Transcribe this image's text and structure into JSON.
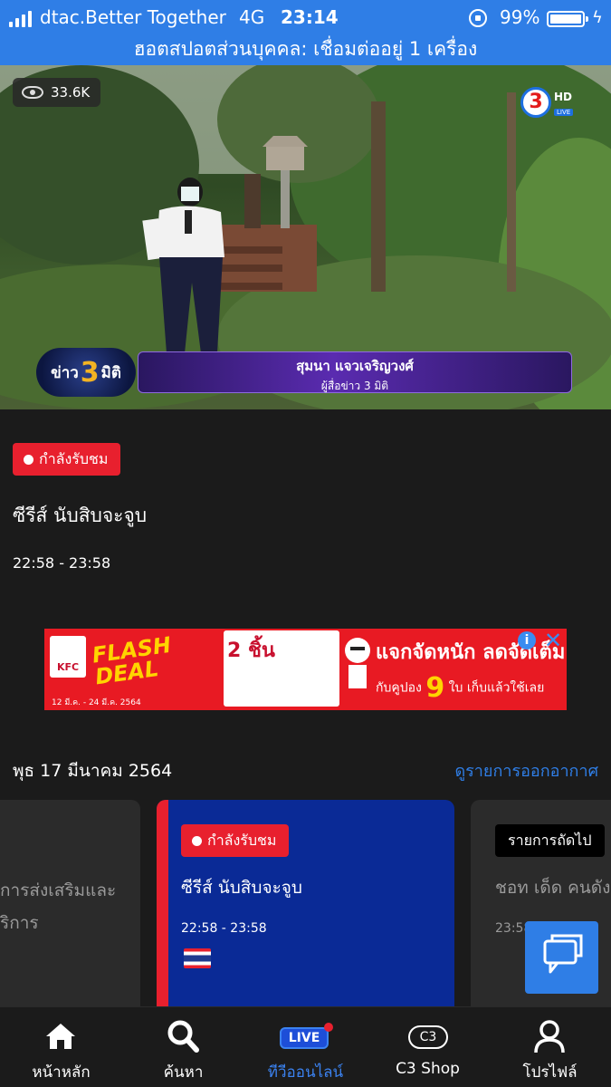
{
  "status_bar": {
    "carrier": "dtac.Better Together",
    "network": "4G",
    "time": "23:14",
    "battery_pct": "99%",
    "battery_level": 0.99,
    "hotspot": "ฮอตสปอตส่วนบุคคล: เชื่อมต่ออยู่ 1 เครื่อง",
    "bar_color": "#2f7ee6"
  },
  "video": {
    "views": "33.6K",
    "channel_logo": "3",
    "channel_hd": "HD",
    "channel_live": "LIVE",
    "program_logo_a": "ข่าว",
    "program_logo_num": "3",
    "program_logo_b": "มิติ",
    "reporter_name": "สุมนา  แจวเจริญวงศ์",
    "reporter_role": "ผู้สื่อข่าว 3 มิติ"
  },
  "now_playing": {
    "badge": "กำลังรับชม",
    "title": "ซีรีส์ นับสิบจะจูบ",
    "time": "22:58 - 23:58"
  },
  "ad": {
    "brand": "KFC",
    "flash_line1": "FLASH",
    "flash_line2": "DEAL",
    "coupon_qty": "2 ชิ้น",
    "headline": "แจกจัดหนัก ลดจัดเต็ม",
    "sub_pre": "กับคูปอง",
    "sub_num": "9",
    "sub_post": "ใบ เก็บแล้วใช้เลย",
    "date": "12 มี.ค. - 24 มี.ค. 2564",
    "accent": "#e81a23"
  },
  "schedule": {
    "date": "พุธ 17 มีนาคม 2564",
    "link": "ดูรายการออกอากาศ",
    "cards": [
      {
        "title_line1": "การส่งเสริมและ",
        "title_line2": "ริการ"
      },
      {
        "badge": "กำลังรับชม",
        "title": "ซีรีส์ นับสิบจะจูบ",
        "time": "22:58 - 23:58"
      },
      {
        "badge": "รายการถัดไป",
        "title": "ชอท เด็ด คนดัง",
        "time": "23:58"
      }
    ]
  },
  "tabbar": {
    "items": [
      {
        "label": "หน้าหลัก",
        "icon": "home-icon"
      },
      {
        "label": "ค้นหา",
        "icon": "search-icon"
      },
      {
        "label": "ทีวีออนไลน์",
        "icon": "live-tv-icon",
        "pill": "LIVE",
        "active": true
      },
      {
        "label": "C3 Shop",
        "icon": "c3-shop-icon",
        "pill": "C3"
      },
      {
        "label": "โปรไฟล์",
        "icon": "profile-icon"
      }
    ],
    "active_color": "#3b82f0"
  }
}
